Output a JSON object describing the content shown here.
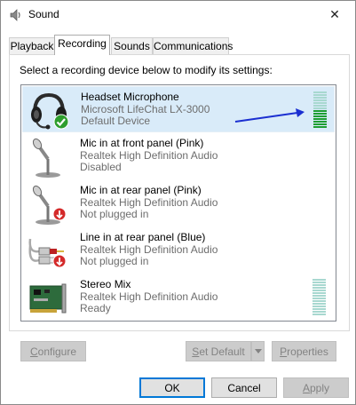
{
  "window": {
    "title": "Sound",
    "close_glyph": "✕"
  },
  "tabs": [
    {
      "label": "Playback",
      "active": false
    },
    {
      "label": "Recording",
      "active": true
    },
    {
      "label": "Sounds",
      "active": false
    },
    {
      "label": "Communications",
      "active": false
    }
  ],
  "instruction": "Select a recording device below to modify its settings:",
  "devices": [
    {
      "name": "Headset Microphone",
      "description": "Microsoft LifeChat LX-3000",
      "status": "Default Device",
      "icon": "headset-icon",
      "badge": "default-check-badge",
      "selected": true,
      "meter_level": 0.5
    },
    {
      "name": "Mic in at front panel (Pink)",
      "description": "Realtek High Definition Audio",
      "status": "Disabled",
      "icon": "microphone-icon",
      "badge": "",
      "selected": false
    },
    {
      "name": "Mic in at rear panel (Pink)",
      "description": "Realtek High Definition Audio",
      "status": "Not plugged in",
      "icon": "microphone-icon",
      "badge": "unplugged-badge",
      "selected": false
    },
    {
      "name": "Line in at rear panel (Blue)",
      "description": "Realtek High Definition Audio",
      "status": "Not plugged in",
      "icon": "rca-cable-icon",
      "badge": "unplugged-badge",
      "selected": false
    },
    {
      "name": "Stereo Mix",
      "description": "Realtek High Definition Audio",
      "status": "Ready",
      "icon": "sound-card-icon",
      "badge": "",
      "selected": false,
      "meter_level": 0
    }
  ],
  "panel_buttons": {
    "configure": {
      "prefix": "",
      "accel": "C",
      "rest": "onfigure"
    },
    "set_default": {
      "prefix": "",
      "accel": "S",
      "rest": "et Default"
    },
    "properties": {
      "prefix": "",
      "accel": "P",
      "rest": "roperties"
    }
  },
  "dialog_buttons": {
    "ok": "OK",
    "cancel": "Cancel",
    "apply": {
      "accel": "A",
      "rest": "pply"
    }
  },
  "colors": {
    "meter_active": "#1e9e33",
    "meter_inactive": "#a8d8d0",
    "selection": "#d9ebf9",
    "arrow": "#1b2fd1",
    "check": "#2e9e2e",
    "unplugged": "#d42a2a"
  }
}
